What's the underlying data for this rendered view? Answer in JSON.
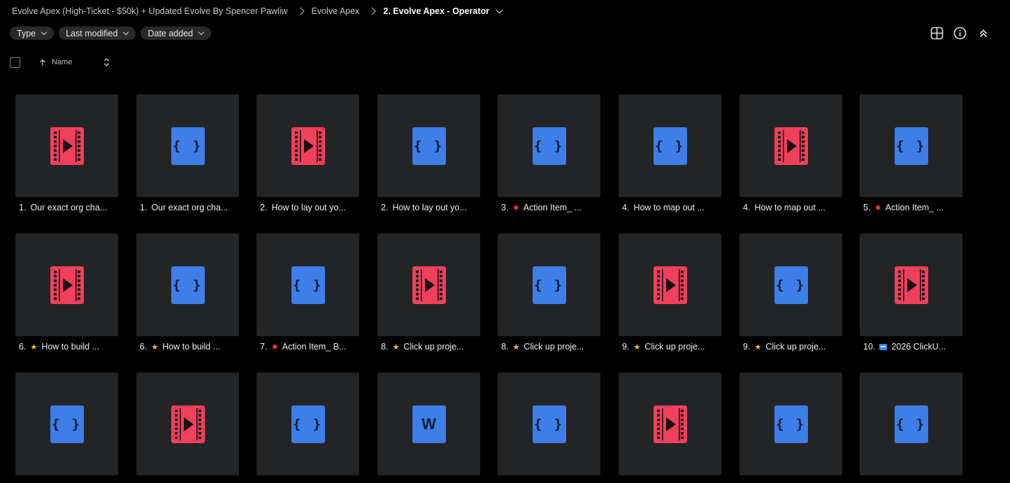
{
  "breadcrumb": {
    "items": [
      {
        "label": "Evolve Apex (High-Ticket - $50k) + Updated Evolve By Spencer Pawliw"
      },
      {
        "label": "Evolve Apex"
      },
      {
        "label": "2. Evolve Apex - Operator"
      }
    ]
  },
  "filters": {
    "type_label": "Type",
    "modified_label": "Last modified",
    "added_label": "Date added"
  },
  "toolbar": {
    "icons": [
      "grid-view-icon",
      "info-icon",
      "collapse-icon"
    ]
  },
  "column_header": {
    "name_label": "Name"
  },
  "colors": {
    "video": "#f0405c",
    "code": "#3d7ee8",
    "tile_bg": "#232426",
    "chip_bg": "#2a2a2c"
  },
  "files": [
    {
      "num": "1.",
      "emoji": "",
      "text": "Our exact org cha...",
      "kind": "video"
    },
    {
      "num": "1.",
      "emoji": "",
      "text": "Our exact org cha...",
      "kind": "code"
    },
    {
      "num": "2.",
      "emoji": "",
      "text": "How to lay out yo...",
      "kind": "video"
    },
    {
      "num": "2.",
      "emoji": "",
      "text": "How to lay out yo...",
      "kind": "code"
    },
    {
      "num": "3.",
      "emoji": "burst",
      "text": "Action Item_ ...",
      "kind": "code"
    },
    {
      "num": "4.",
      "emoji": "",
      "text": "How to map out ...",
      "kind": "code"
    },
    {
      "num": "4.",
      "emoji": "",
      "text": "How to map out ...",
      "kind": "video"
    },
    {
      "num": "5.",
      "emoji": "burst",
      "text": "Action Item_ ...",
      "kind": "code"
    },
    {
      "num": "6.",
      "emoji": "star",
      "text": "How to build ...",
      "kind": "video"
    },
    {
      "num": "6.",
      "emoji": "star",
      "text": "How to build ...",
      "kind": "code"
    },
    {
      "num": "7.",
      "emoji": "burst",
      "text": "Action Item_ B...",
      "kind": "code"
    },
    {
      "num": "8.",
      "emoji": "star",
      "text": "Click up proje...",
      "kind": "video"
    },
    {
      "num": "8.",
      "emoji": "star",
      "text": "Click up proje...",
      "kind": "code"
    },
    {
      "num": "9.",
      "emoji": "star",
      "text": "Click up proje...",
      "kind": "video"
    },
    {
      "num": "9.",
      "emoji": "star",
      "text": "Click up proje...",
      "kind": "code"
    },
    {
      "num": "10.",
      "emoji": "blue",
      "text": "2026 ClickU...",
      "kind": "video"
    },
    {
      "num": "",
      "emoji": "",
      "text": "",
      "kind": "code"
    },
    {
      "num": "",
      "emoji": "",
      "text": "",
      "kind": "video"
    },
    {
      "num": "",
      "emoji": "",
      "text": "",
      "kind": "code"
    },
    {
      "num": "",
      "emoji": "",
      "text": "",
      "kind": "word"
    },
    {
      "num": "",
      "emoji": "",
      "text": "",
      "kind": "code"
    },
    {
      "num": "",
      "emoji": "",
      "text": "",
      "kind": "video"
    },
    {
      "num": "",
      "emoji": "",
      "text": "",
      "kind": "code"
    },
    {
      "num": "",
      "emoji": "",
      "text": "",
      "kind": "code"
    }
  ],
  "icon_glyphs": {
    "code": "{}",
    "word": "W"
  }
}
